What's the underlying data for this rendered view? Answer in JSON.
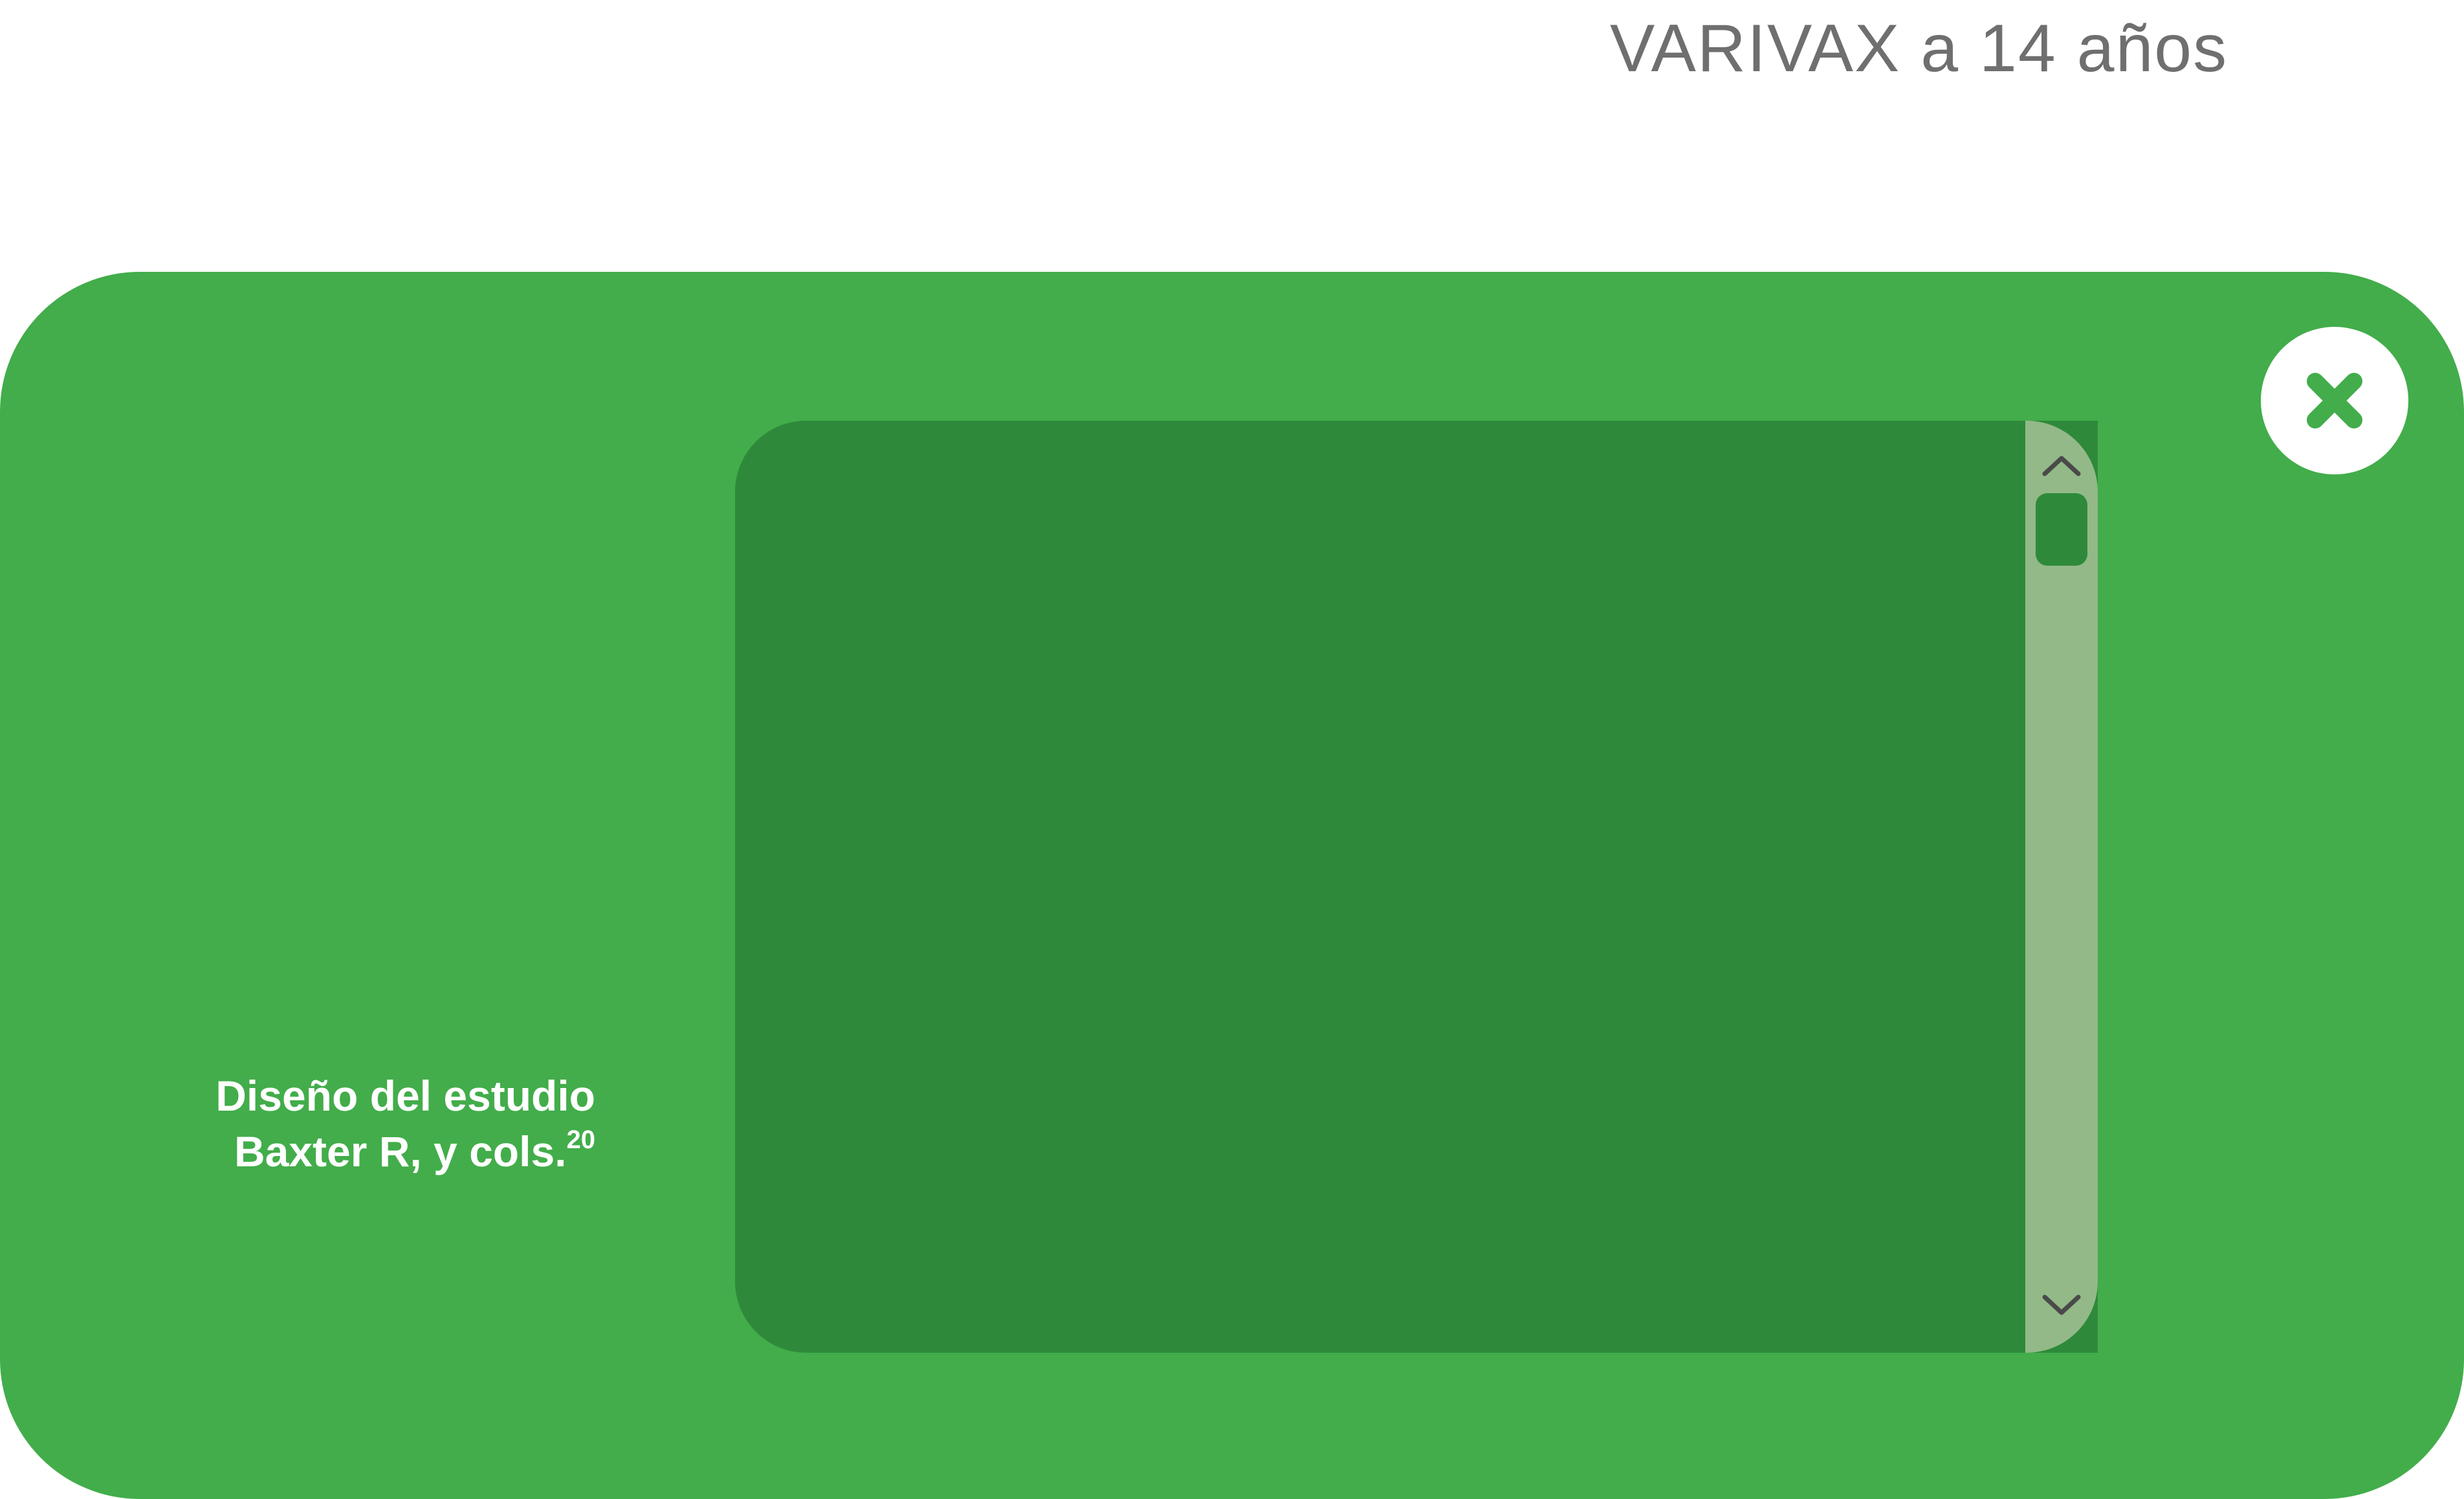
{
  "header": {
    "title": "VARIVAX a 14 años"
  },
  "modal": {
    "background_color": "#42ad4a",
    "close_icon": "close-icon",
    "caption": {
      "line1": "Diseño del estudio",
      "line2": "Baxter R, y cols.",
      "reference": "20"
    },
    "content_panel": {
      "background_color": "#2e8a3a"
    },
    "scrollbar": {
      "track_color": "#93b988",
      "up_icon": "chevron-up-icon",
      "down_icon": "chevron-down-icon",
      "scroll_position": 0
    }
  }
}
